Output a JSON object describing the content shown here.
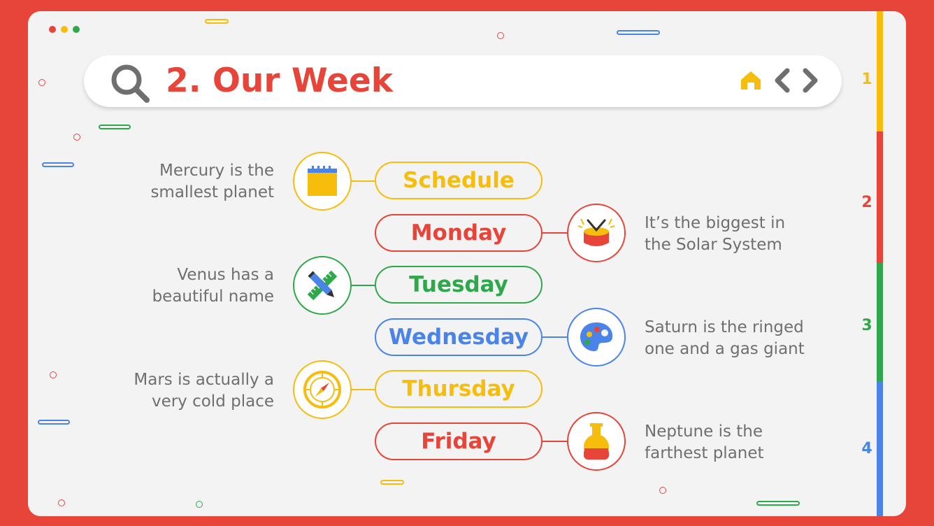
{
  "colors": {
    "red": "#E8453A",
    "yellow": "#F7BD0D",
    "green": "#2EA84A",
    "blue": "#4A84E8",
    "text": "#6F6F6F"
  },
  "header": {
    "title": "2. Our Week"
  },
  "icons": {
    "search": "search-icon",
    "home": "home-icon",
    "prev": "chevron-left-icon",
    "next": "chevron-right-icon"
  },
  "sidebar": {
    "sections": [
      "1",
      "2",
      "3",
      "4"
    ]
  },
  "rows": [
    {
      "day": "Schedule",
      "note": "Mercury is the smallest planet",
      "note_lines": [
        "Mercury is the",
        "smallest planet"
      ],
      "icon": "calendar-icon",
      "color": "#F7BD0D"
    },
    {
      "day": "Monday",
      "note": "It’s the biggest in the Solar System",
      "note_lines": [
        "It’s the biggest in",
        "the Solar System"
      ],
      "icon": "drum-icon",
      "color": "#E8453A"
    },
    {
      "day": "Tuesday",
      "note": "Venus has a beautiful name",
      "note_lines": [
        "Venus has a",
        "beautiful name"
      ],
      "icon": "pencil-ruler-icon",
      "color": "#2EA84A"
    },
    {
      "day": "Wednesday",
      "note": "Saturn is the ringed one and a gas giant",
      "note_lines": [
        "Saturn is the ringed",
        "one and a gas giant"
      ],
      "icon": "palette-icon",
      "color": "#4A84E8"
    },
    {
      "day": "Thursday",
      "note": "Mars is actually a very cold place",
      "note_lines": [
        "Mars is actually a",
        "very cold place"
      ],
      "icon": "compass-icon",
      "color": "#F7BD0D"
    },
    {
      "day": "Friday",
      "note": "Neptune is the farthest planet",
      "note_lines": [
        "Neptune is the",
        "farthest planet"
      ],
      "icon": "flask-icon",
      "color": "#E8453A"
    }
  ]
}
